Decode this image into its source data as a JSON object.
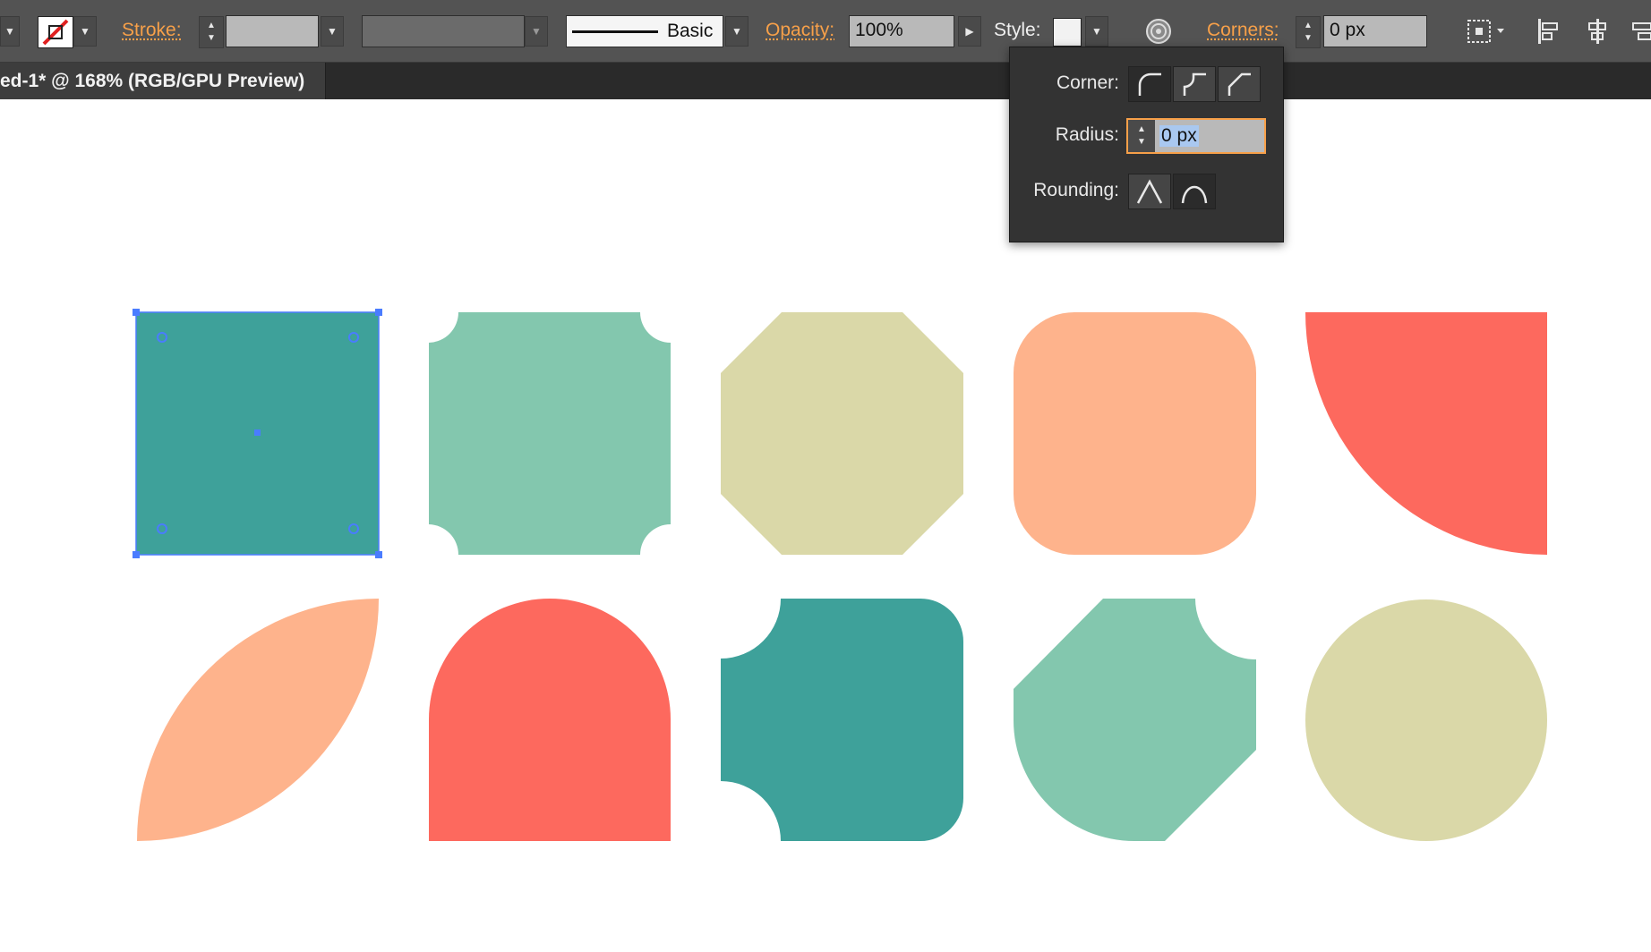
{
  "control_bar": {
    "stroke_label": "Stroke:",
    "stroke_profile_label": "Basic",
    "opacity_label": "Opacity:",
    "opacity_value": "100%",
    "style_label": "Style:",
    "corners_label": "Corners:",
    "corners_value": "0 px"
  },
  "document_tab": {
    "title": "ed-1* @ 168% (RGB/GPU Preview)"
  },
  "corners_panel": {
    "corner_label": "Corner:",
    "radius_label": "Radius:",
    "radius_value": "0 px",
    "rounding_label": "Rounding:",
    "corner_types": [
      "round",
      "inverted-round",
      "chamfer"
    ],
    "rounding_types": [
      "absolute",
      "relative"
    ]
  },
  "colors": {
    "teal": "#3ea19a",
    "mint": "#83c7ae",
    "khaki": "#dad8a8",
    "peach": "#feb38c",
    "coral": "#fd695e",
    "selection": "#4a7cff",
    "accent_label": "#f7a049"
  }
}
